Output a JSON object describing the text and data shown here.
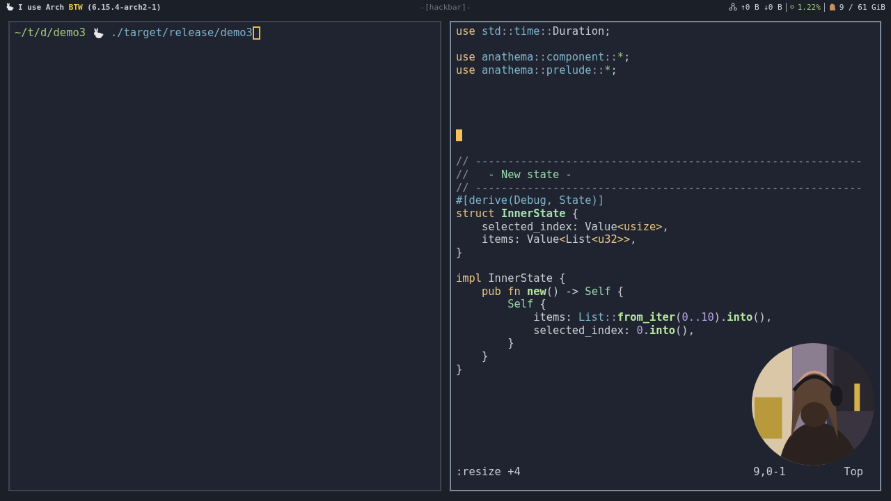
{
  "top_bar": {
    "left": [
      {
        "text": "I use Arch ",
        "kind": "plain"
      },
      {
        "text": "BTW",
        "kind": "accent"
      },
      {
        "text": " (6.15.4-arch2-1)",
        "kind": "plain"
      }
    ],
    "center": "-[hackbar]-",
    "network": "↑0 B ↓0 B",
    "cpu": "1.22%",
    "memory": "9 / 61 GiB"
  },
  "terminal": {
    "cwd": "~/t/d/demo3",
    "command": "./target/release/demo3"
  },
  "editor": {
    "lines": [
      {
        "kind": "code",
        "tokens": [
          {
            "text": "use ",
            "kind": "keyword"
          },
          {
            "text": "std",
            "kind": "path"
          },
          {
            "text": "::",
            "kind": "punct"
          },
          {
            "text": "time",
            "kind": "path"
          },
          {
            "text": "::",
            "kind": "punct"
          },
          {
            "text": "Duration;",
            "kind": "plain"
          }
        ]
      },
      {
        "kind": "blank"
      },
      {
        "kind": "code",
        "tokens": [
          {
            "text": "use ",
            "kind": "keyword"
          },
          {
            "text": "anathema",
            "kind": "path"
          },
          {
            "text": "::",
            "kind": "punct"
          },
          {
            "text": "component",
            "kind": "path"
          },
          {
            "text": "::",
            "kind": "punct"
          },
          {
            "text": "*",
            "kind": "star"
          },
          {
            "text": ";",
            "kind": "plain"
          }
        ]
      },
      {
        "kind": "code",
        "tokens": [
          {
            "text": "use ",
            "kind": "keyword"
          },
          {
            "text": "anathema",
            "kind": "path"
          },
          {
            "text": "::",
            "kind": "punct"
          },
          {
            "text": "prelude",
            "kind": "path"
          },
          {
            "text": "::",
            "kind": "punct"
          },
          {
            "text": "*",
            "kind": "star"
          },
          {
            "text": ";",
            "kind": "plain"
          }
        ]
      },
      {
        "kind": "blank"
      },
      {
        "kind": "blank"
      },
      {
        "kind": "blank"
      },
      {
        "kind": "blank"
      },
      {
        "kind": "cursor"
      },
      {
        "kind": "blank"
      },
      {
        "kind": "code",
        "tokens": [
          {
            "text": "// ------------------------------------------------------------",
            "kind": "comment"
          }
        ]
      },
      {
        "kind": "code",
        "tokens": [
          {
            "text": "//   ",
            "kind": "comment"
          },
          {
            "text": "- New state -",
            "kind": "doc"
          }
        ]
      },
      {
        "kind": "code",
        "tokens": [
          {
            "text": "// ------------------------------------------------------------",
            "kind": "comment"
          }
        ]
      },
      {
        "kind": "code",
        "tokens": [
          {
            "text": "#[derive(Debug, State)]",
            "kind": "attr"
          }
        ]
      },
      {
        "kind": "code",
        "tokens": [
          {
            "text": "struct ",
            "kind": "keyword"
          },
          {
            "text": "InnerState",
            "kind": "typename"
          },
          {
            "text": " {",
            "kind": "plain"
          }
        ]
      },
      {
        "kind": "code",
        "tokens": [
          {
            "text": "    selected_index: Value",
            "kind": "plain"
          },
          {
            "text": "<usize>",
            "kind": "generic"
          },
          {
            "text": ",",
            "kind": "plain"
          }
        ]
      },
      {
        "kind": "code",
        "tokens": [
          {
            "text": "    items: Value",
            "kind": "plain"
          },
          {
            "text": "<",
            "kind": "generic"
          },
          {
            "text": "List",
            "kind": "plain"
          },
          {
            "text": "<u32>>",
            "kind": "generic"
          },
          {
            "text": ",",
            "kind": "plain"
          }
        ]
      },
      {
        "kind": "code",
        "tokens": [
          {
            "text": "}",
            "kind": "plain"
          }
        ]
      },
      {
        "kind": "blank"
      },
      {
        "kind": "code",
        "tokens": [
          {
            "text": "impl ",
            "kind": "keyword"
          },
          {
            "text": "InnerState {",
            "kind": "plain"
          }
        ]
      },
      {
        "kind": "code",
        "tokens": [
          {
            "text": "    pub fn ",
            "kind": "keyword"
          },
          {
            "text": "new",
            "kind": "func"
          },
          {
            "text": "() -> ",
            "kind": "plain"
          },
          {
            "text": "Self",
            "kind": "type"
          },
          {
            "text": " {",
            "kind": "plain"
          }
        ]
      },
      {
        "kind": "code",
        "tokens": [
          {
            "text": "        Self",
            "kind": "type"
          },
          {
            "text": " {",
            "kind": "plain"
          }
        ]
      },
      {
        "kind": "code",
        "tokens": [
          {
            "text": "            items: ",
            "kind": "plain"
          },
          {
            "text": "List",
            "kind": "path"
          },
          {
            "text": "::",
            "kind": "punct"
          },
          {
            "text": "from_iter",
            "kind": "func"
          },
          {
            "text": "(",
            "kind": "plain"
          },
          {
            "text": "0..10",
            "kind": "number"
          },
          {
            "text": ").",
            "kind": "plain"
          },
          {
            "text": "into",
            "kind": "func"
          },
          {
            "text": "(),",
            "kind": "plain"
          }
        ]
      },
      {
        "kind": "code",
        "tokens": [
          {
            "text": "            selected_index: ",
            "kind": "plain"
          },
          {
            "text": "0",
            "kind": "number"
          },
          {
            "text": ".",
            "kind": "plain"
          },
          {
            "text": "into",
            "kind": "func"
          },
          {
            "text": "(),",
            "kind": "plain"
          }
        ]
      },
      {
        "kind": "code",
        "tokens": [
          {
            "text": "        }",
            "kind": "plain"
          }
        ]
      },
      {
        "kind": "code",
        "tokens": [
          {
            "text": "    }",
            "kind": "plain"
          }
        ]
      },
      {
        "kind": "code",
        "tokens": [
          {
            "text": "}",
            "kind": "plain"
          }
        ]
      }
    ],
    "command_line": ":resize +4",
    "position": "9,0-1",
    "scroll": "Top"
  }
}
